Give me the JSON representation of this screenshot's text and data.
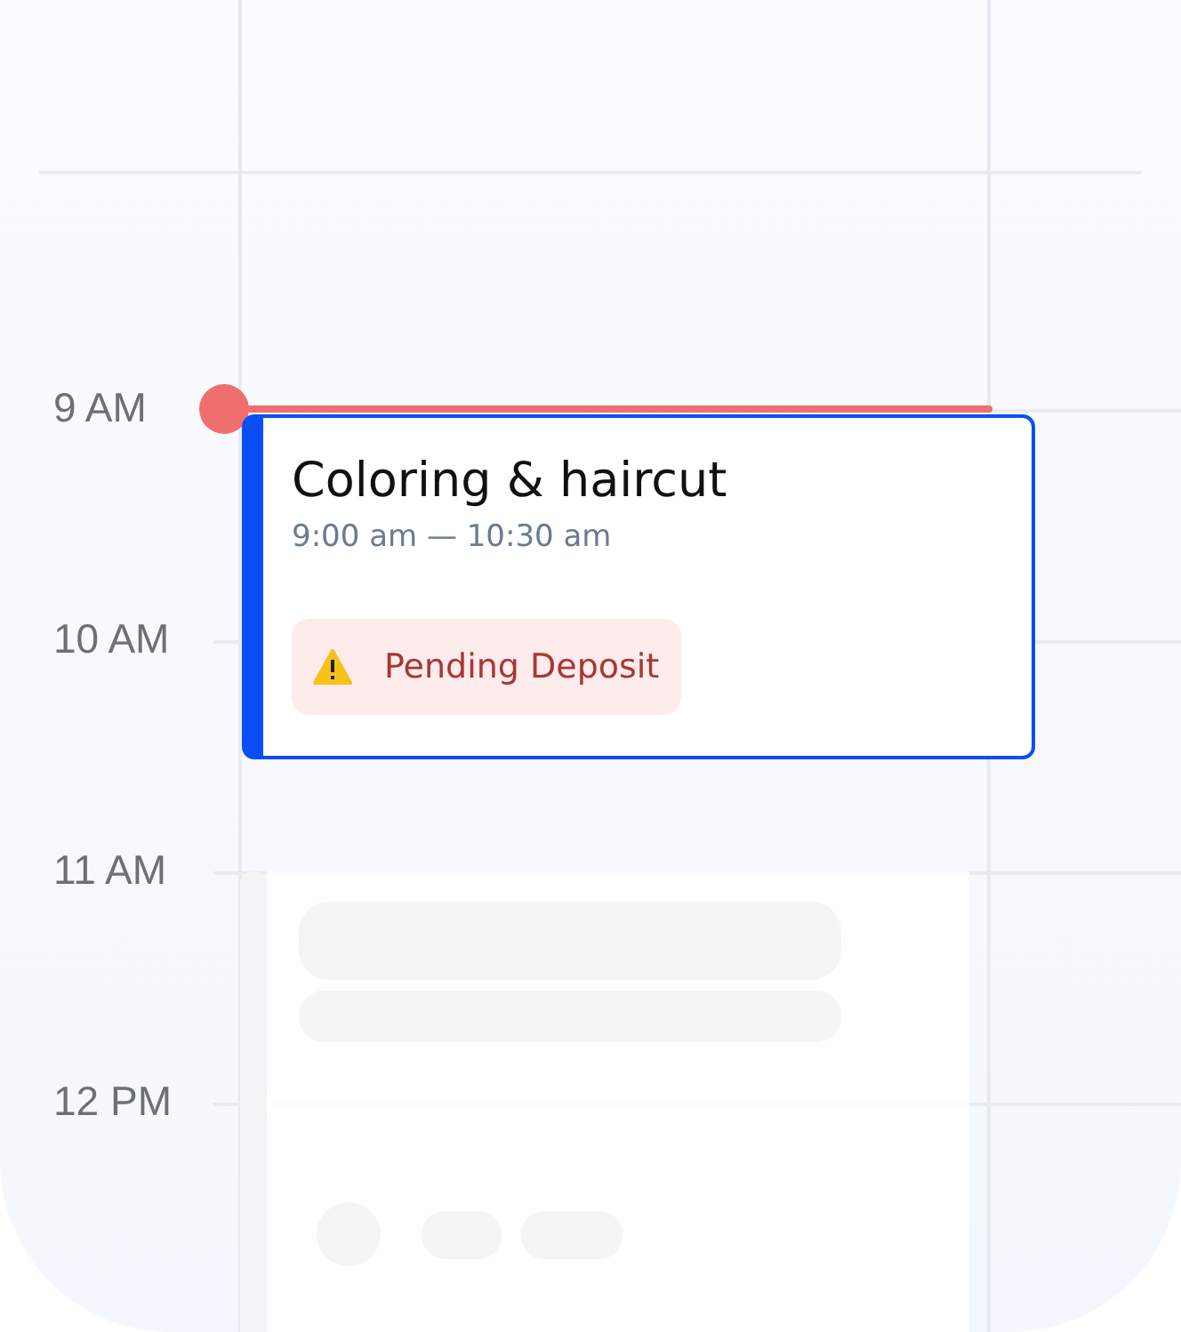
{
  "hours": [
    "9 AM",
    "10 AM",
    "11 AM",
    "12 PM"
  ],
  "event": {
    "title": "Coloring & haircut",
    "time": "9:00 am — 10:30 am",
    "status": {
      "label": "Pending Deposit"
    }
  }
}
